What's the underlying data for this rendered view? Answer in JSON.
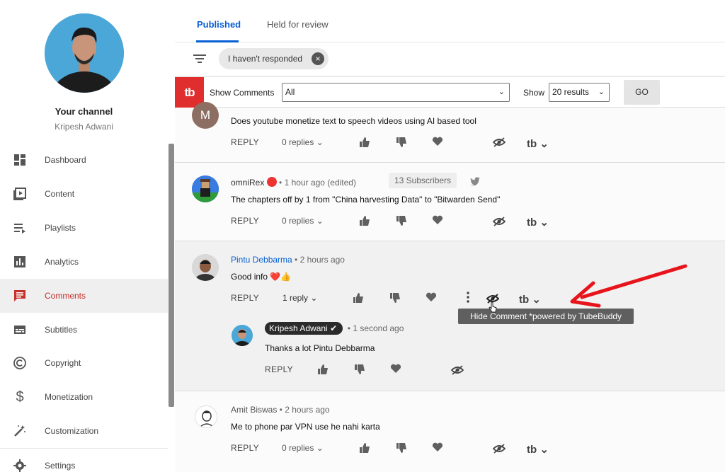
{
  "sidebar": {
    "channel_title": "Your channel",
    "channel_name": "Kripesh Adwani",
    "items": [
      {
        "label": "Dashboard",
        "icon": "dashboard-icon"
      },
      {
        "label": "Content",
        "icon": "content-icon"
      },
      {
        "label": "Playlists",
        "icon": "playlists-icon"
      },
      {
        "label": "Analytics",
        "icon": "analytics-icon"
      },
      {
        "label": "Comments",
        "icon": "comments-icon",
        "active": true
      },
      {
        "label": "Subtitles",
        "icon": "subtitles-icon"
      },
      {
        "label": "Copyright",
        "icon": "copyright-icon"
      },
      {
        "label": "Monetization",
        "icon": "monetization-icon"
      },
      {
        "label": "Customization",
        "icon": "customization-icon"
      },
      {
        "label": "Settings",
        "icon": "settings-icon"
      }
    ]
  },
  "tabs": [
    {
      "label": "Published",
      "active": true
    },
    {
      "label": "Held for review"
    }
  ],
  "filter": {
    "chip_label": "I haven't responded"
  },
  "tubebuddy": {
    "logo": "tb",
    "show_comments_label": "Show Comments",
    "show_comments_value": "All",
    "show_label": "Show",
    "show_value": "20 results",
    "go_label": "GO"
  },
  "comments": [
    {
      "author": "M",
      "text": "Does youtube monetize text to speech videos using AI based tool",
      "reply_label": "REPLY",
      "replies_label": "0 replies"
    },
    {
      "author": "omniRex",
      "time": "1 hour ago (edited)",
      "badge": "13 Subscribers",
      "text": "The chapters off by 1 from \"China harvesting Data\" to \"Bitwarden Send\"",
      "reply_label": "REPLY",
      "replies_label": "0 replies"
    },
    {
      "author": "Pintu Debbarma",
      "time": "2 hours ago",
      "text": "Good info ❤️👍",
      "reply_label": "REPLY",
      "replies_label": "1 reply",
      "reply": {
        "author": "Kripesh Adwani",
        "time": "1 second ago",
        "text": "Thanks a lot Pintu Debbarma",
        "reply_label": "REPLY"
      }
    },
    {
      "author": "Amit Biswas",
      "time": "2 hours ago",
      "text": "Me to phone par VPN use he nahi karta",
      "reply_label": "REPLY",
      "replies_label": "0 replies"
    }
  ],
  "tooltip": "Hide Comment *powered by TubeBuddy",
  "colors": {
    "accent": "#065fd4",
    "active_nav": "#c4302b",
    "tubebuddy": "#e02e2e",
    "arrow": "#e8141c"
  }
}
